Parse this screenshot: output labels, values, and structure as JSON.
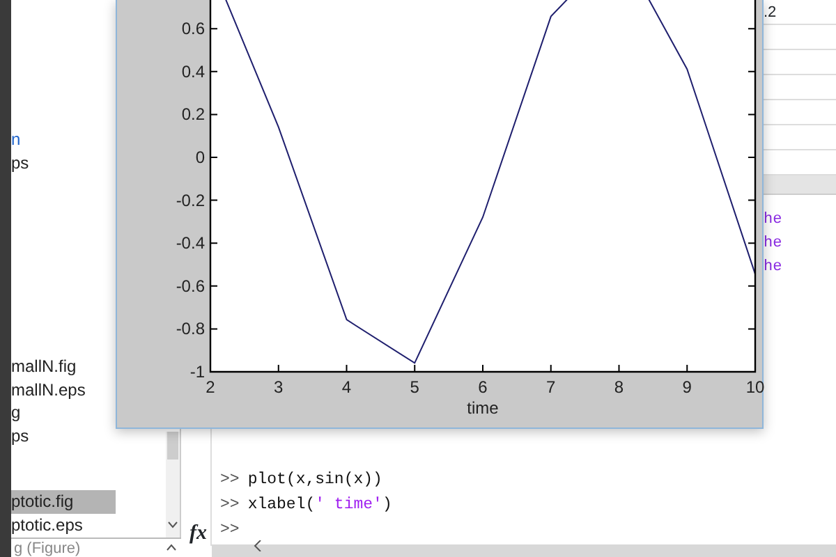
{
  "file_browser": {
    "groups": [
      [
        {
          "name": "n",
          "kind": "link",
          "selected": false
        },
        {
          "name": "ps",
          "kind": "file",
          "selected": false
        }
      ],
      [
        {
          "name": "mallN.fig",
          "kind": "file",
          "selected": false
        },
        {
          "name": "mallN.eps",
          "kind": "file",
          "selected": false
        },
        {
          "name": "g",
          "kind": "file",
          "selected": false
        },
        {
          "name": "ps",
          "kind": "file",
          "selected": false
        }
      ],
      [
        {
          "name": "ptotic.fig",
          "kind": "file",
          "selected": true
        },
        {
          "name": "ptotic.eps",
          "kind": "file",
          "selected": false
        }
      ]
    ],
    "details_header": "g (Figure)"
  },
  "workspace": {
    "value_cells": [
      ".2"
    ],
    "name_cells": [
      "he",
      "he",
      "he"
    ]
  },
  "command_window": {
    "lines": [
      {
        "prompt": ">>",
        "segments": [
          {
            "text": "plot(x,sin(x))",
            "kind": "code"
          }
        ]
      },
      {
        "prompt": ">>",
        "segments": [
          {
            "text": "xlabel(",
            "kind": "code"
          },
          {
            "text": "' time'",
            "kind": "string"
          },
          {
            "text": ")",
            "kind": "code"
          }
        ]
      }
    ],
    "input_prompt": ">>",
    "fx_label": "fx"
  },
  "figure": {
    "chart_data": {
      "type": "line",
      "xlabel": "time",
      "x": [
        2,
        3,
        4,
        5,
        6,
        7,
        8,
        9,
        10
      ],
      "series": [
        {
          "color": "#1f1f6e",
          "values": [
            0.909,
            0.141,
            -0.757,
            -0.959,
            -0.279,
            0.657,
            0.989,
            0.412,
            -0.544
          ]
        }
      ],
      "xlim": [
        2,
        10
      ],
      "ylim": [
        -1,
        1
      ],
      "xticks": [
        2,
        3,
        4,
        5,
        6,
        7,
        8,
        9,
        10
      ],
      "yticks": [
        -1,
        -0.8,
        -0.6,
        -0.4,
        -0.2,
        0,
        0.2,
        0.4,
        0.6
      ]
    }
  }
}
